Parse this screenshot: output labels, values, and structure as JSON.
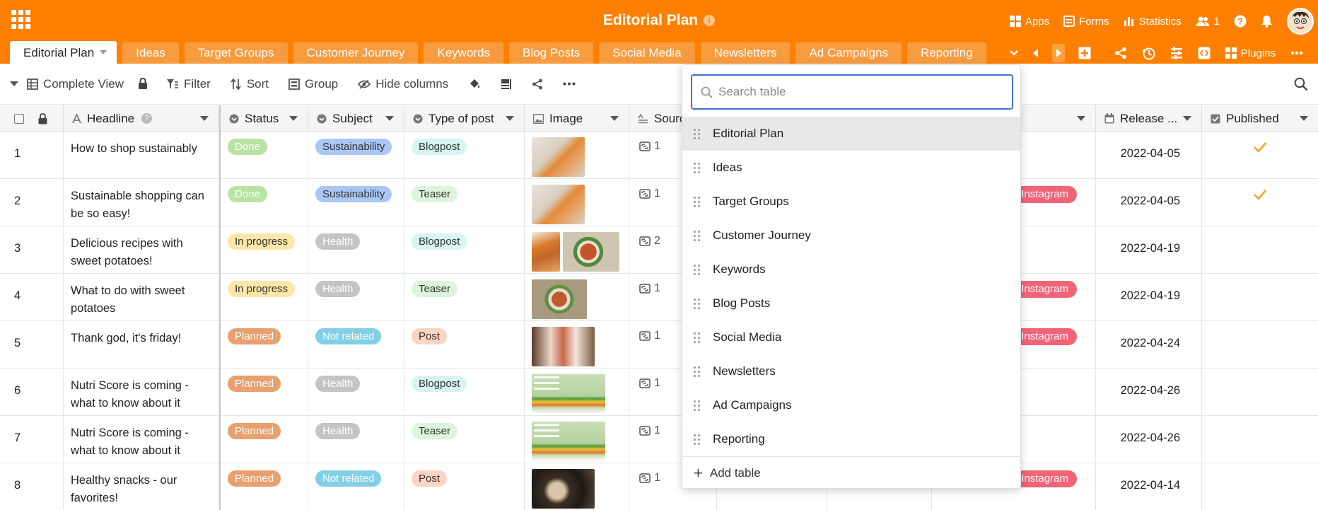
{
  "app": {
    "title": "Editorial Plan",
    "info_icon": "info-icon",
    "accent": "#ff8000"
  },
  "header_right": {
    "apps": "Apps",
    "forms": "Forms",
    "statistics": "Statistics",
    "collaborators_count": "1",
    "plugins": "Plugins"
  },
  "tabs": [
    "Editorial Plan",
    "Ideas",
    "Target Groups",
    "Customer Journey",
    "Keywords",
    "Blog Posts",
    "Social Media",
    "Newsletters",
    "Ad Campaigns",
    "Reporting"
  ],
  "toolbar": {
    "view": "Complete View",
    "filter": "Filter",
    "sort": "Sort",
    "group": "Group",
    "hide_columns": "Hide columns"
  },
  "columns": {
    "headline": "Headline",
    "status": "Status",
    "subject": "Subject",
    "type": "Type of post",
    "image": "Image",
    "source": "Sourc",
    "release": "Release ...",
    "published": "Published"
  },
  "rows": [
    {
      "n": "1",
      "headline": "How to shop sustainably",
      "status": "Done",
      "subject": "Sustainability",
      "type": "Blogpost",
      "links": "1",
      "channel": "",
      "date": "2022-04-05",
      "published": true
    },
    {
      "n": "2",
      "headline": "Sustainable shopping can be so easy!",
      "status": "Done",
      "subject": "Sustainability",
      "type": "Teaser",
      "links": "1",
      "channel": "Instagram",
      "date": "2022-04-05",
      "published": true
    },
    {
      "n": "3",
      "headline": "Delicious recipes with sweet potatoes!",
      "status": "In progress",
      "subject": "Health",
      "type": "Blogpost",
      "links": "2",
      "channel": "",
      "date": "2022-04-19",
      "published": false
    },
    {
      "n": "4",
      "headline": "What to do with sweet potatoes",
      "status": "In progress",
      "subject": "Health",
      "type": "Teaser",
      "links": "1",
      "channel": "Instagram",
      "date": "2022-04-19",
      "published": false
    },
    {
      "n": "5",
      "headline": "Thank god, it's friday!",
      "status": "Planned",
      "subject": "Not related",
      "type": "Post",
      "links": "1",
      "channel": "Instagram",
      "date": "2022-04-24",
      "published": false
    },
    {
      "n": "6",
      "headline": "Nutri Score is coming - what to know about it",
      "status": "Planned",
      "subject": "Health",
      "type": "Blogpost",
      "links": "1",
      "channel": "",
      "date": "2022-04-26",
      "published": false
    },
    {
      "n": "7",
      "headline": "Nutri Score is coming - what to know about it",
      "status": "Planned",
      "subject": "Health",
      "type": "Teaser",
      "links": "1",
      "channel": "",
      "date": "2022-04-26",
      "published": false
    },
    {
      "n": "8",
      "headline": "Healthy snacks - our favorites!",
      "status": "Planned",
      "subject": "Not related",
      "type": "Post",
      "links": "1",
      "channel": "Instagram",
      "date": "2022-04-14",
      "published": false
    }
  ],
  "popup": {
    "search_placeholder": "Search table",
    "items": [
      "Editorial Plan",
      "Ideas",
      "Target Groups",
      "Customer Journey",
      "Keywords",
      "Blog Posts",
      "Social Media",
      "Newsletters",
      "Ad Campaigns",
      "Reporting"
    ],
    "add_table": "Add table"
  },
  "colors": {
    "done": "#b8e3a3",
    "in_progress": "#fde6a8",
    "planned": "#e8a06e",
    "sustainability": "#a9c7f5",
    "health": "#c4c4c4",
    "not_related": "#83cfe5",
    "blogpost": "#d6f5f3",
    "teaser": "#dcf5dc",
    "post": "#fbd4c2",
    "instagram": "#f06478",
    "check": "#f5a623"
  }
}
